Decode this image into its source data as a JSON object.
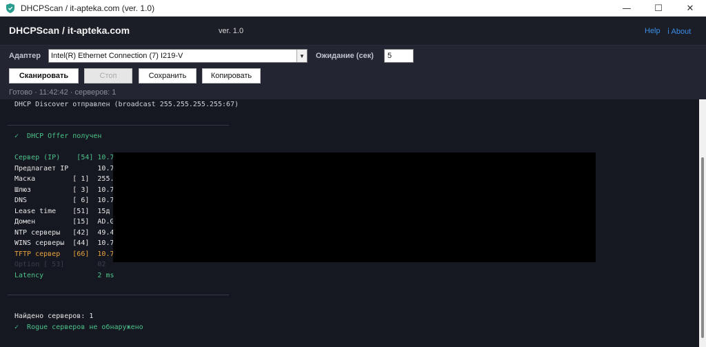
{
  "window": {
    "title": "DHCPScan  /  it-apteka.com  (ver. 1.0)",
    "minimize": "—",
    "maximize": "☐",
    "close": "✕"
  },
  "header": {
    "app_name": "DHCPScan  /  it-apteka.com",
    "version": "ver. 1.0",
    "help": "Help",
    "about": "ⅰ About"
  },
  "toolbar": {
    "adapter_label": "Адаптер",
    "adapter_value": "Intel(R) Ethernet Connection (7) I219-V",
    "timeout_label": "Ожидание (сек)",
    "timeout_value": "5",
    "scan_button": "Сканировать",
    "stop_button": "Стоп",
    "save_button": "Сохранить",
    "copy_button": "Копировать",
    "status": "Готово  ·  11:42:42  ·  серверов: 1"
  },
  "console": {
    "discover": "DHCP Discover отправлен (broadcast 255.255.255.255:67)",
    "offer": "✓  DHCP Offer получен",
    "rows": [
      {
        "text": "Сервер (IP)    [54] 10.7",
        "color": "#4cc38a"
      },
      {
        "text": "Предлагает IP       10.7",
        "color": "#e8e8e8"
      },
      {
        "text": "Маска         [ 1]  255.",
        "color": "#e8e8e8"
      },
      {
        "text": "Шлюз          [ 3]  10.7",
        "color": "#e8e8e8"
      },
      {
        "text": "DNS           [ 6]  10.7",
        "color": "#e8e8e8"
      },
      {
        "text": "Lease time    [51]  15д",
        "color": "#e8e8e8"
      },
      {
        "text": "Домен         [15]  AD.G",
        "color": "#e8e8e8"
      },
      {
        "text": "NTP серверы   [42]  49.4",
        "color": "#e8e8e8"
      },
      {
        "text": "WINS серверы  [44]  10.7",
        "color": "#e8e8e8"
      },
      {
        "text": "TFTP сервер   [66]  10.7",
        "color": "#e8a33c"
      },
      {
        "text": "Option [ 53]        02",
        "color": "#3b3f4a"
      },
      {
        "text": "Latency             2 ms",
        "color": "#4cc38a"
      }
    ],
    "found": "Найдено серверов: 1",
    "rogue": "✓  Rogue серверов не обнаружено"
  },
  "colors": {
    "green": "#4cc38a",
    "orange": "#e8a33c",
    "link": "#3b8fe8"
  }
}
